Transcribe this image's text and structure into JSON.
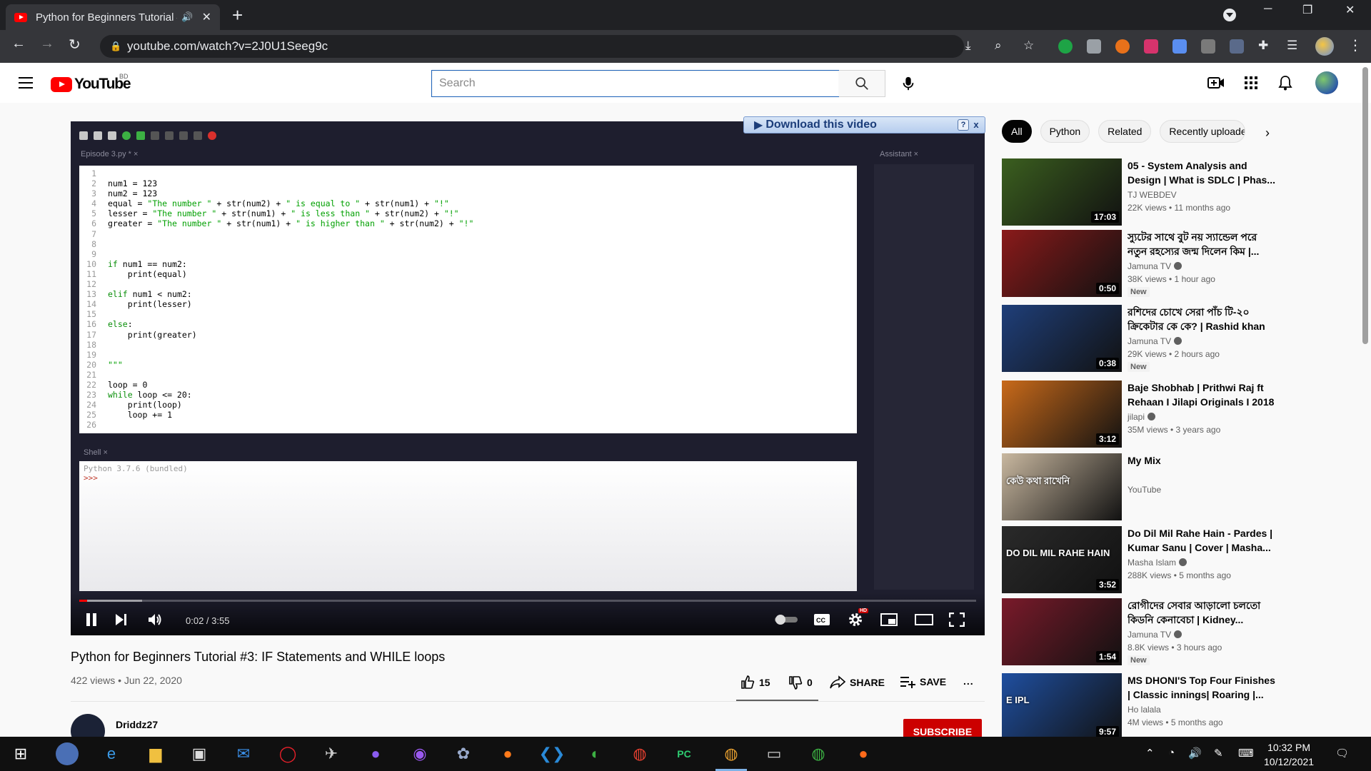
{
  "browser": {
    "tab_title": "Python for Beginners Tutorial #3: IF Statements and WHILE loops",
    "url": "youtube.com/watch?v=2J0U1Seeg9c"
  },
  "masthead": {
    "logo_text": "YouTube",
    "country_code": "BD",
    "search_placeholder": "Search"
  },
  "player": {
    "download_badge": "Download this video",
    "download_help": "?",
    "download_close": "x",
    "time_current": "0:02",
    "time_total": "3:55",
    "time_display": "0:02 / 3:55",
    "progress_played": 0.009,
    "progress_loaded": 0.07,
    "hd_badge": "HD",
    "ide": {
      "editor_tab": "Episode 3.py * ×",
      "assistant_tab": "Assistant ×",
      "shell_tab": "Shell ×",
      "shell_banner": "Python 3.7.6 (bundled)",
      "shell_prompt": ">>>",
      "line_numbers": "1\n2\n3\n4\n5\n6\n7\n8\n9\n10\n11\n12\n13\n14\n15\n16\n17\n18\n19\n20\n21\n22\n23\n24\n25\n26",
      "code_lines": [
        "",
        "num1 = 123",
        "num2 = 123",
        "equal = \"The number \" + str(num2) + \" is equal to \" + str(num1) + \"!\"",
        "lesser = \"The number \" + str(num1) + \" is less than \" + str(num2) + \"!\"",
        "greater = \"The number \" + str(num1) + \" is higher than \" + str(num2) + \"!\"",
        "",
        "",
        "",
        "if num1 == num2:",
        "    print(equal)",
        "",
        "elif num1 < num2:",
        "    print(lesser)",
        "",
        "else:",
        "    print(greater)",
        "",
        "",
        "\"\"\"",
        "",
        "loop = 0",
        "while loop <= 20:",
        "    print(loop)",
        "    loop += 1",
        ""
      ]
    }
  },
  "video": {
    "title": "Python for Beginners Tutorial #3: IF Statements and WHILE loops",
    "views": "422 views",
    "date": "Jun 22, 2020",
    "meta": "422 views • Jun 22, 2020",
    "likes": "15",
    "dislikes": "0",
    "share_label": "SHARE",
    "save_label": "SAVE",
    "more_label": "...",
    "channel_name": "Driddz27",
    "subscribe_label": "SUBSCRIBE"
  },
  "chips": [
    "All",
    "Python",
    "Related",
    "Recently uploaded"
  ],
  "recommendations": [
    {
      "title": "05 - System Analysis and Design | What is SDLC | Phas...",
      "channel": "TJ WEBDEV",
      "stats": "22K views • 11 months ago",
      "duration": "17:03",
      "verified": false,
      "badge": "",
      "thumb_color": "#3b5f1f"
    },
    {
      "title": "স্যুটের সাথে বুট নয় স্যান্ডেল পরে নতুন রহস্যের জন্ম দিলেন কিম |...",
      "channel": "Jamuna TV",
      "stats": "38K views • 1 hour ago",
      "duration": "0:50",
      "verified": true,
      "badge": "New",
      "thumb_color": "#8a1a1a"
    },
    {
      "title": "রশিদের চোখে সেরা পাঁচ টি-২০ ক্রিকেটার কে কে? | Rashid khan",
      "channel": "Jamuna TV",
      "stats": "29K views • 2 hours ago",
      "duration": "0:38",
      "verified": true,
      "badge": "New",
      "thumb_color": "#1f3f7a"
    },
    {
      "title": "Baje Shobhab | Prithwi Raj ft Rehaan I Jilapi Originals I 2018",
      "channel": "jilapi",
      "stats": "35M views • 3 years ago",
      "duration": "3:12",
      "verified": true,
      "badge": "",
      "thumb_color": "#c96a1a"
    },
    {
      "title": "My Mix",
      "channel": "YouTube",
      "stats": "",
      "duration": "",
      "verified": false,
      "badge": "",
      "thumb_color": "#c9b8a0",
      "thumb_text": "কেউ কথা রাখেনি"
    },
    {
      "title": "Do Dil Mil Rahe Hain - Pardes | Kumar Sanu | Cover | Masha...",
      "channel": "Masha Islam",
      "stats": "288K views • 5 months ago",
      "duration": "3:52",
      "verified": true,
      "badge": "",
      "thumb_color": "#2a2a2a",
      "thumb_text": "DO DIL MIL RAHE HAIN"
    },
    {
      "title": "রোগীদের সেবার আড়ালো চলতো কিডনি কেনাবেচা | Kidney...",
      "channel": "Jamuna TV",
      "stats": "8.8K views • 3 hours ago",
      "duration": "1:54",
      "verified": true,
      "badge": "New",
      "thumb_color": "#7a1a2a"
    },
    {
      "title": "MS DHONI'S Top Four Finishes | Classic innings| Roaring |...",
      "channel": "Ho lalala",
      "stats": "4M views • 5 months ago",
      "duration": "9:57",
      "verified": false,
      "badge": "",
      "thumb_color": "#1f4fa0",
      "thumb_text": "E IPL"
    }
  ],
  "taskbar": {
    "time": "10:32 PM",
    "date": "10/12/2021"
  }
}
